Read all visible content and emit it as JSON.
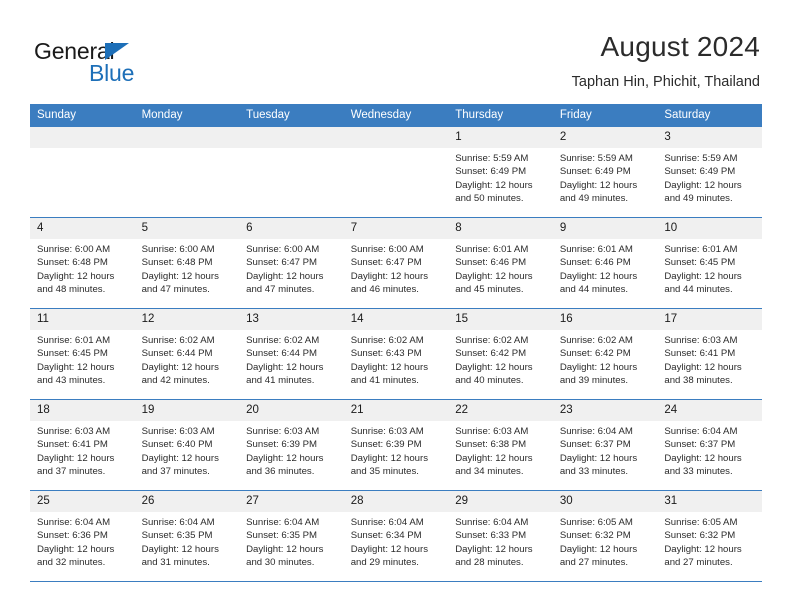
{
  "brand": {
    "name_top": "General",
    "name_bottom": "Blue",
    "accent_color": "#1d6fb8",
    "triangle_icon": "triangle-icon"
  },
  "header": {
    "title": "August 2024",
    "subtitle": "Taphan Hin, Phichit, Thailand"
  },
  "calendar": {
    "header_bg": "#3b7dc0",
    "daynum_bg": "#f0f0f0",
    "weekday_headers": [
      "Sunday",
      "Monday",
      "Tuesday",
      "Wednesday",
      "Thursday",
      "Friday",
      "Saturday"
    ],
    "weeks": [
      [
        {
          "day": "",
          "empty": true
        },
        {
          "day": "",
          "empty": true
        },
        {
          "day": "",
          "empty": true
        },
        {
          "day": "",
          "empty": true
        },
        {
          "day": "1",
          "sunrise": "Sunrise: 5:59 AM",
          "sunset": "Sunset: 6:49 PM",
          "daylight_1": "Daylight: 12 hours",
          "daylight_2": "and 50 minutes."
        },
        {
          "day": "2",
          "sunrise": "Sunrise: 5:59 AM",
          "sunset": "Sunset: 6:49 PM",
          "daylight_1": "Daylight: 12 hours",
          "daylight_2": "and 49 minutes."
        },
        {
          "day": "3",
          "sunrise": "Sunrise: 5:59 AM",
          "sunset": "Sunset: 6:49 PM",
          "daylight_1": "Daylight: 12 hours",
          "daylight_2": "and 49 minutes."
        }
      ],
      [
        {
          "day": "4",
          "sunrise": "Sunrise: 6:00 AM",
          "sunset": "Sunset: 6:48 PM",
          "daylight_1": "Daylight: 12 hours",
          "daylight_2": "and 48 minutes."
        },
        {
          "day": "5",
          "sunrise": "Sunrise: 6:00 AM",
          "sunset": "Sunset: 6:48 PM",
          "daylight_1": "Daylight: 12 hours",
          "daylight_2": "and 47 minutes."
        },
        {
          "day": "6",
          "sunrise": "Sunrise: 6:00 AM",
          "sunset": "Sunset: 6:47 PM",
          "daylight_1": "Daylight: 12 hours",
          "daylight_2": "and 47 minutes."
        },
        {
          "day": "7",
          "sunrise": "Sunrise: 6:00 AM",
          "sunset": "Sunset: 6:47 PM",
          "daylight_1": "Daylight: 12 hours",
          "daylight_2": "and 46 minutes."
        },
        {
          "day": "8",
          "sunrise": "Sunrise: 6:01 AM",
          "sunset": "Sunset: 6:46 PM",
          "daylight_1": "Daylight: 12 hours",
          "daylight_2": "and 45 minutes."
        },
        {
          "day": "9",
          "sunrise": "Sunrise: 6:01 AM",
          "sunset": "Sunset: 6:46 PM",
          "daylight_1": "Daylight: 12 hours",
          "daylight_2": "and 44 minutes."
        },
        {
          "day": "10",
          "sunrise": "Sunrise: 6:01 AM",
          "sunset": "Sunset: 6:45 PM",
          "daylight_1": "Daylight: 12 hours",
          "daylight_2": "and 44 minutes."
        }
      ],
      [
        {
          "day": "11",
          "sunrise": "Sunrise: 6:01 AM",
          "sunset": "Sunset: 6:45 PM",
          "daylight_1": "Daylight: 12 hours",
          "daylight_2": "and 43 minutes."
        },
        {
          "day": "12",
          "sunrise": "Sunrise: 6:02 AM",
          "sunset": "Sunset: 6:44 PM",
          "daylight_1": "Daylight: 12 hours",
          "daylight_2": "and 42 minutes."
        },
        {
          "day": "13",
          "sunrise": "Sunrise: 6:02 AM",
          "sunset": "Sunset: 6:44 PM",
          "daylight_1": "Daylight: 12 hours",
          "daylight_2": "and 41 minutes."
        },
        {
          "day": "14",
          "sunrise": "Sunrise: 6:02 AM",
          "sunset": "Sunset: 6:43 PM",
          "daylight_1": "Daylight: 12 hours",
          "daylight_2": "and 41 minutes."
        },
        {
          "day": "15",
          "sunrise": "Sunrise: 6:02 AM",
          "sunset": "Sunset: 6:42 PM",
          "daylight_1": "Daylight: 12 hours",
          "daylight_2": "and 40 minutes."
        },
        {
          "day": "16",
          "sunrise": "Sunrise: 6:02 AM",
          "sunset": "Sunset: 6:42 PM",
          "daylight_1": "Daylight: 12 hours",
          "daylight_2": "and 39 minutes."
        },
        {
          "day": "17",
          "sunrise": "Sunrise: 6:03 AM",
          "sunset": "Sunset: 6:41 PM",
          "daylight_1": "Daylight: 12 hours",
          "daylight_2": "and 38 minutes."
        }
      ],
      [
        {
          "day": "18",
          "sunrise": "Sunrise: 6:03 AM",
          "sunset": "Sunset: 6:41 PM",
          "daylight_1": "Daylight: 12 hours",
          "daylight_2": "and 37 minutes."
        },
        {
          "day": "19",
          "sunrise": "Sunrise: 6:03 AM",
          "sunset": "Sunset: 6:40 PM",
          "daylight_1": "Daylight: 12 hours",
          "daylight_2": "and 37 minutes."
        },
        {
          "day": "20",
          "sunrise": "Sunrise: 6:03 AM",
          "sunset": "Sunset: 6:39 PM",
          "daylight_1": "Daylight: 12 hours",
          "daylight_2": "and 36 minutes."
        },
        {
          "day": "21",
          "sunrise": "Sunrise: 6:03 AM",
          "sunset": "Sunset: 6:39 PM",
          "daylight_1": "Daylight: 12 hours",
          "daylight_2": "and 35 minutes."
        },
        {
          "day": "22",
          "sunrise": "Sunrise: 6:03 AM",
          "sunset": "Sunset: 6:38 PM",
          "daylight_1": "Daylight: 12 hours",
          "daylight_2": "and 34 minutes."
        },
        {
          "day": "23",
          "sunrise": "Sunrise: 6:04 AM",
          "sunset": "Sunset: 6:37 PM",
          "daylight_1": "Daylight: 12 hours",
          "daylight_2": "and 33 minutes."
        },
        {
          "day": "24",
          "sunrise": "Sunrise: 6:04 AM",
          "sunset": "Sunset: 6:37 PM",
          "daylight_1": "Daylight: 12 hours",
          "daylight_2": "and 33 minutes."
        }
      ],
      [
        {
          "day": "25",
          "sunrise": "Sunrise: 6:04 AM",
          "sunset": "Sunset: 6:36 PM",
          "daylight_1": "Daylight: 12 hours",
          "daylight_2": "and 32 minutes."
        },
        {
          "day": "26",
          "sunrise": "Sunrise: 6:04 AM",
          "sunset": "Sunset: 6:35 PM",
          "daylight_1": "Daylight: 12 hours",
          "daylight_2": "and 31 minutes."
        },
        {
          "day": "27",
          "sunrise": "Sunrise: 6:04 AM",
          "sunset": "Sunset: 6:35 PM",
          "daylight_1": "Daylight: 12 hours",
          "daylight_2": "and 30 minutes."
        },
        {
          "day": "28",
          "sunrise": "Sunrise: 6:04 AM",
          "sunset": "Sunset: 6:34 PM",
          "daylight_1": "Daylight: 12 hours",
          "daylight_2": "and 29 minutes."
        },
        {
          "day": "29",
          "sunrise": "Sunrise: 6:04 AM",
          "sunset": "Sunset: 6:33 PM",
          "daylight_1": "Daylight: 12 hours",
          "daylight_2": "and 28 minutes."
        },
        {
          "day": "30",
          "sunrise": "Sunrise: 6:05 AM",
          "sunset": "Sunset: 6:32 PM",
          "daylight_1": "Daylight: 12 hours",
          "daylight_2": "and 27 minutes."
        },
        {
          "day": "31",
          "sunrise": "Sunrise: 6:05 AM",
          "sunset": "Sunset: 6:32 PM",
          "daylight_1": "Daylight: 12 hours",
          "daylight_2": "and 27 minutes."
        }
      ]
    ]
  }
}
